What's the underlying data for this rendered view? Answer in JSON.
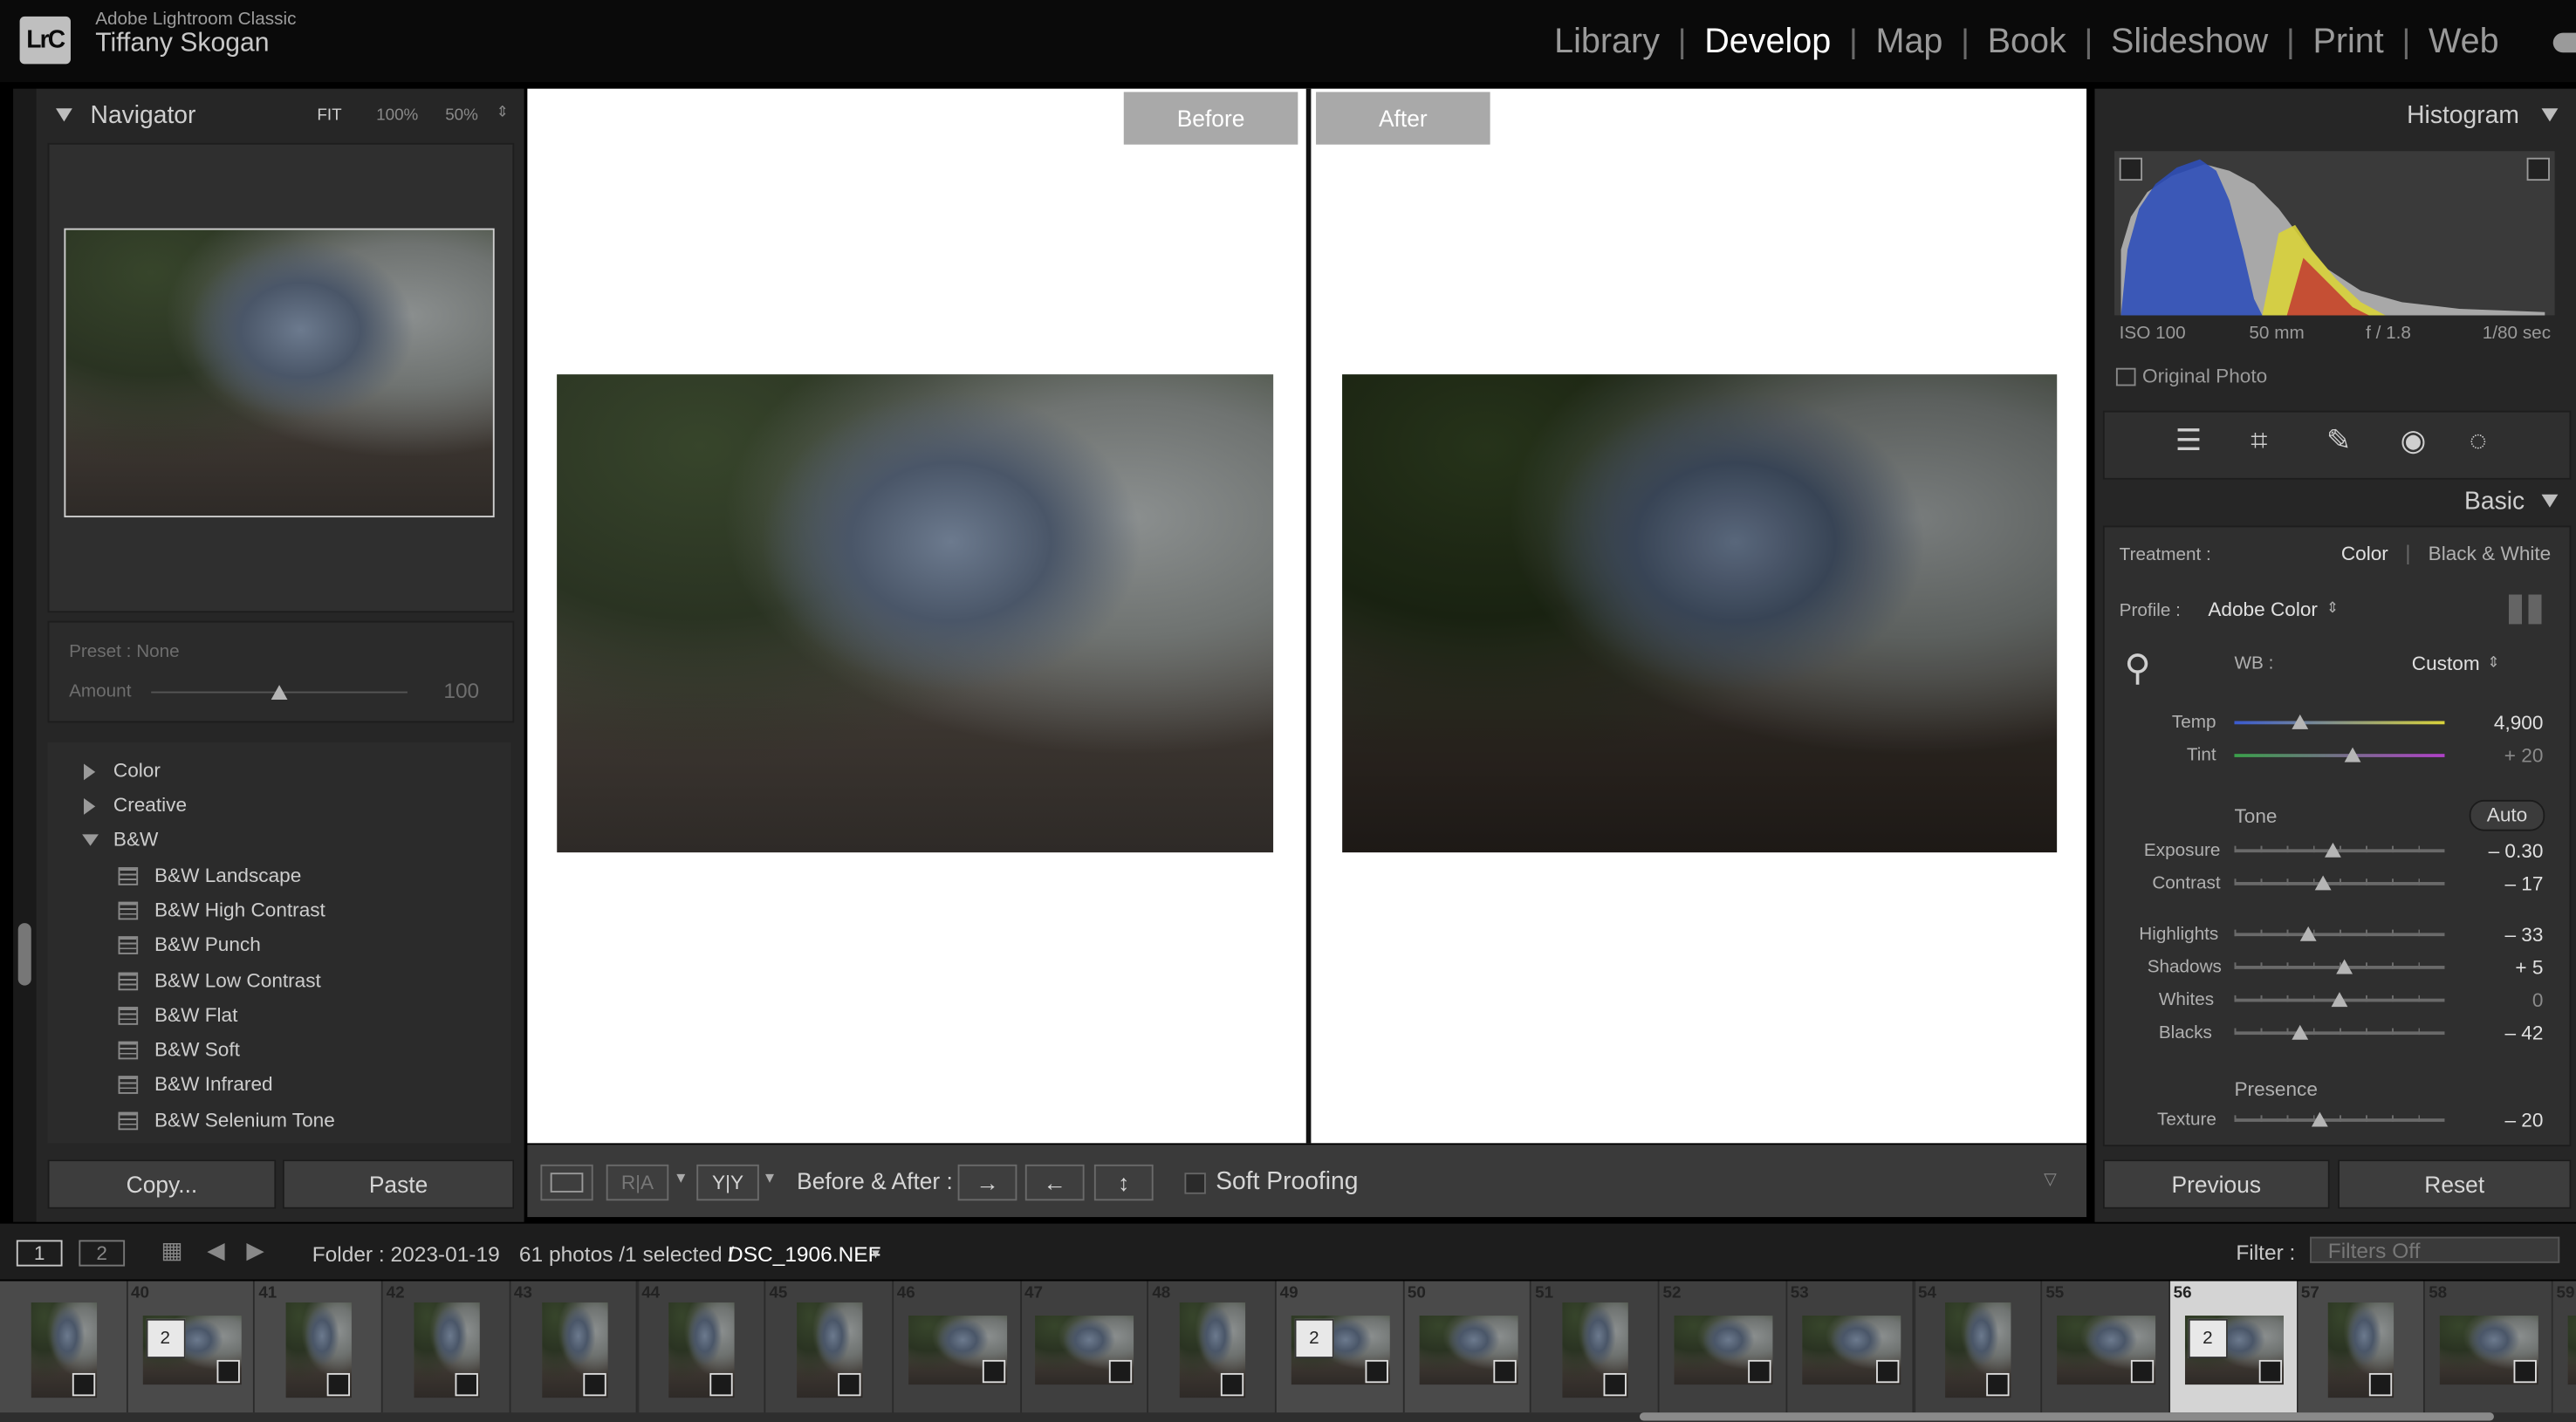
{
  "app": {
    "name": "Adobe Lightroom Classic",
    "logo_text": "LrC",
    "user": "Tiffany Skogan"
  },
  "modules": [
    "Library",
    "Develop",
    "Map",
    "Book",
    "Slideshow",
    "Print",
    "Web"
  ],
  "active_module": "Develop",
  "navigator": {
    "title": "Navigator",
    "fit_label": "FIT",
    "zoom_1": "100%",
    "zoom_2": "50%"
  },
  "preset_amount": {
    "preset_label": "Preset : None",
    "amount_label": "Amount",
    "amount_value": "100",
    "amount_fraction": 0.5
  },
  "presets": {
    "collapsed": [
      "Color",
      "Creative"
    ],
    "expanded_group": "B&W",
    "items": [
      "B&W Landscape",
      "B&W High Contrast",
      "B&W Punch",
      "B&W Low Contrast",
      "B&W Flat",
      "B&W Soft",
      "B&W Infrared",
      "B&W Selenium Tone"
    ]
  },
  "left_buttons": {
    "copy": "Copy...",
    "paste": "Paste"
  },
  "view": {
    "before_label": "Before",
    "after_label": "After"
  },
  "toolbar": {
    "ra_label": "R|A",
    "yy_label": "Y|Y",
    "before_after_label": "Before & After :",
    "soft_proofing": "Soft Proofing"
  },
  "histogram": {
    "title": "Histogram",
    "iso": "ISO 100",
    "focal": "50 mm",
    "aperture": "f / 1.8",
    "shutter": "1/80 sec",
    "original_photo": "Original Photo"
  },
  "basic": {
    "title": "Basic",
    "treatment_label": "Treatment :",
    "treatment_color": "Color",
    "treatment_bw": "Black & White",
    "profile_label": "Profile :",
    "profile_value": "Adobe Color",
    "wb_label": "WB :",
    "wb_value": "Custom",
    "tone_label": "Tone",
    "auto_label": "Auto",
    "presence_label": "Presence",
    "sliders": [
      {
        "name": "Temp",
        "value": "4,900",
        "pos": 0.31
      },
      {
        "name": "Tint",
        "value": "+ 20",
        "pos": 0.56
      },
      {
        "name": "Exposure",
        "value": "– 0.30",
        "pos": 0.47
      },
      {
        "name": "Contrast",
        "value": "– 17",
        "pos": 0.42
      },
      {
        "name": "Highlights",
        "value": "– 33",
        "pos": 0.35
      },
      {
        "name": "Shadows",
        "value": "+ 5",
        "pos": 0.52
      },
      {
        "name": "Whites",
        "value": "0",
        "pos": 0.5
      },
      {
        "name": "Blacks",
        "value": "– 42",
        "pos": 0.31
      },
      {
        "name": "Texture",
        "value": "– 20",
        "pos": 0.41
      }
    ]
  },
  "right_buttons": {
    "previous": "Previous",
    "reset": "Reset"
  },
  "filmbar": {
    "view1": "1",
    "view2": "2",
    "folder": "Folder : 2023-01-19",
    "count": "61 photos /1 selected /",
    "filename": "DSC_1906.NEF",
    "filter_label": "Filter :",
    "filter_value": "Filters Off"
  },
  "filmstrip": [
    {
      "num": "",
      "badge": "",
      "alt": false,
      "sel": false
    },
    {
      "num": "40",
      "badge": "2",
      "alt": false,
      "sel": false
    },
    {
      "num": "41",
      "badge": "",
      "alt": false,
      "sel": false
    },
    {
      "num": "42",
      "badge": "",
      "alt": true,
      "sel": false
    },
    {
      "num": "43",
      "badge": "",
      "alt": true,
      "sel": false
    },
    {
      "num": "44",
      "badge": "",
      "alt": true,
      "sel": false
    },
    {
      "num": "45",
      "badge": "",
      "alt": true,
      "sel": false
    },
    {
      "num": "46",
      "badge": "",
      "alt": true,
      "sel": false
    },
    {
      "num": "47",
      "badge": "",
      "alt": true,
      "sel": false
    },
    {
      "num": "48",
      "badge": "",
      "alt": true,
      "sel": false
    },
    {
      "num": "49",
      "badge": "2",
      "alt": false,
      "sel": false
    },
    {
      "num": "50",
      "badge": "",
      "alt": false,
      "sel": false
    },
    {
      "num": "51",
      "badge": "",
      "alt": true,
      "sel": false
    },
    {
      "num": "52",
      "badge": "",
      "alt": true,
      "sel": false
    },
    {
      "num": "53",
      "badge": "",
      "alt": true,
      "sel": false
    },
    {
      "num": "54",
      "badge": "",
      "alt": true,
      "sel": false
    },
    {
      "num": "55",
      "badge": "",
      "alt": true,
      "sel": false
    },
    {
      "num": "56",
      "badge": "2",
      "alt": false,
      "sel": true
    },
    {
      "num": "57",
      "badge": "",
      "alt": false,
      "sel": false
    },
    {
      "num": "58",
      "badge": "",
      "alt": true,
      "sel": false
    },
    {
      "num": "59",
      "badge": "",
      "alt": true,
      "sel": false
    }
  ]
}
